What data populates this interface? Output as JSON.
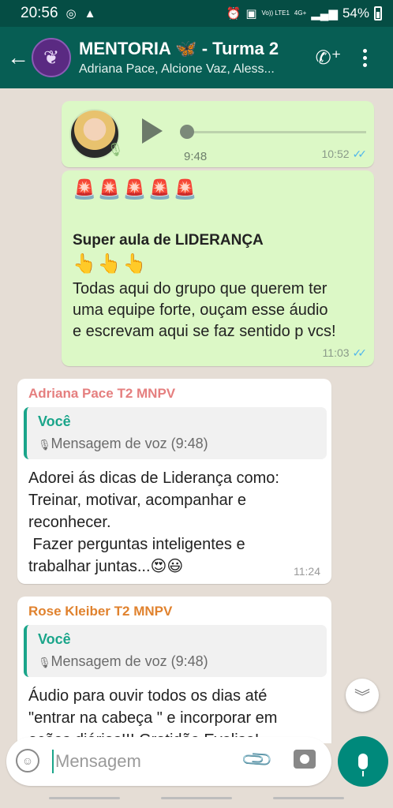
{
  "status_bar": {
    "time": "20:56",
    "network_text": "Vo)) LTE1",
    "signal_text": "4G+",
    "battery": "54%"
  },
  "header": {
    "title": "MENTORIA 🦋 - Turma 2",
    "subtitle": "Adriana Pace, Alcione Vaz, Aless...",
    "icons": [
      "back-arrow-icon",
      "group-avatar",
      "add-call-icon",
      "more-options-icon"
    ]
  },
  "messages": [
    {
      "type": "voice",
      "direction": "out",
      "duration": "9:48",
      "time": "10:52"
    },
    {
      "type": "text",
      "direction": "out",
      "emojis_top": "🚨🚨🚨🚨🚨",
      "headline": "Super aula de LIDERANÇA",
      "pointing": "👆👆👆",
      "lines": [
        "Todas aqui do grupo que querem ter",
        "uma equipe forte, ouçam esse áudio",
        "e escrevam aqui se faz sentido p vcs!"
      ],
      "time": "11:03"
    },
    {
      "type": "reply",
      "direction": "in",
      "sender": "Adriana Pace T2 MNPV",
      "sender_color": "#e57f7f",
      "quote_name": "Você",
      "quote_text": "Mensagem de voz (9:48)",
      "lines": [
        "Adorei ás dicas de Liderança como:",
        "Treinar, motivar, acompanhar e",
        "reconhecer.",
        " Fazer perguntas inteligentes e",
        "trabalhar juntas...😍😃"
      ],
      "time": "11:24"
    },
    {
      "type": "reply",
      "direction": "in",
      "sender": "Rose Kleiber T2 MNPV",
      "sender_color": "#e0822e",
      "quote_name": "Você",
      "quote_text": "Mensagem de voz (9:48)",
      "lines": [
        "Áudio para ouvir todos os dias até",
        "\"entrar na cabeça \" e incorporar em",
        "ações diárias!!! Gratidão Evelise!"
      ]
    }
  ],
  "input": {
    "placeholder": "Mensagem"
  },
  "colors": {
    "header": "#075e54",
    "statusbar": "#054d44",
    "outgoing": "#dcf8c6",
    "incoming": "#ffffff",
    "accent": "#00897b",
    "background": "#e5ddd5"
  }
}
